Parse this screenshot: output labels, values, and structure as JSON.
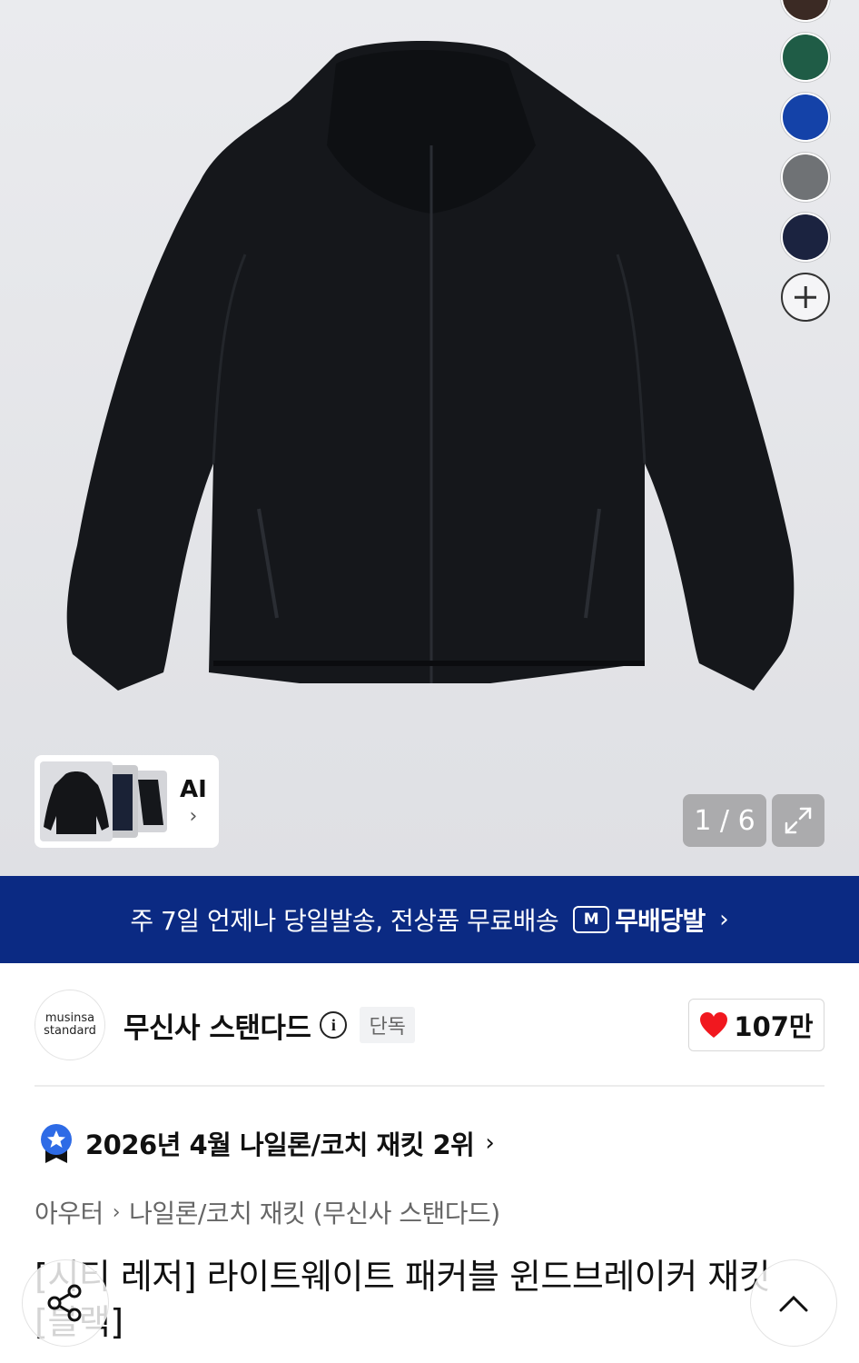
{
  "swatches": [
    {
      "color": "#3b2a24"
    },
    {
      "color": "#1f5c46"
    },
    {
      "color": "#1442a8"
    },
    {
      "color": "#6f7275"
    },
    {
      "color": "#1b2340"
    }
  ],
  "swatch_more_icon": "plus-icon",
  "ai_card": {
    "label": "AI",
    "chevron": "›"
  },
  "gallery": {
    "counter": "1 / 6",
    "expand_icon": "expand-icon"
  },
  "banner": {
    "text": "주 7일 언제나 당일발송, 전상품 무료배송",
    "logo": "M",
    "brand": "무배당발",
    "chevron": "›",
    "background": "#0b2a83"
  },
  "brand": {
    "logo_line1": "musinsa",
    "logo_line2": "standard",
    "name": "무신사 스탠다드",
    "info": "i",
    "tag": "단독",
    "likes": "107만"
  },
  "ranking": {
    "text": "2026년 4월 나일론/코치 재킷 2위",
    "chevron": "›"
  },
  "breadcrumb": [
    "아우터",
    "나일론/코치 재킷 (무신사 스탠다드)"
  ],
  "breadcrumb_sep": "›",
  "product": {
    "title": "[시티 레저] 라이트웨이트 패커블 윈드브레이커 재킷 [블랙]"
  }
}
